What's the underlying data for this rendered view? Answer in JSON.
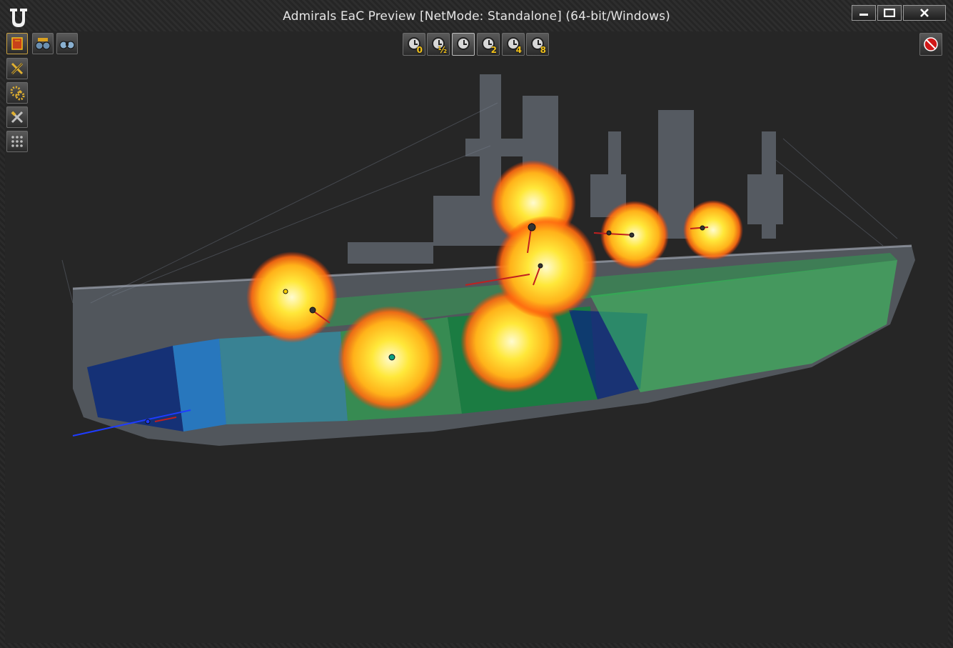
{
  "window": {
    "title": "Admirals EaC Preview [NetMode: Standalone]  (64-bit/Windows)",
    "logo_icon": "unreal-engine-logo",
    "buttons": {
      "minimize_icon": "minimize-icon",
      "maximize_icon": "maximize-icon",
      "close_icon": "close-icon"
    }
  },
  "toolbar": {
    "left_tools": [
      {
        "id": "book",
        "icon": "manual-book-icon",
        "active": true
      },
      {
        "id": "crew",
        "icon": "crew-binoculars-icon",
        "active": false
      },
      {
        "id": "binoculars",
        "icon": "binoculars-icon",
        "active": false
      },
      {
        "id": "hammer",
        "icon": "hammer-pick-icon",
        "active": false
      },
      {
        "id": "gears",
        "icon": "gears-icon",
        "active": false
      },
      {
        "id": "repair",
        "icon": "crossed-tools-icon",
        "active": false
      },
      {
        "id": "grid",
        "icon": "grid-dots-icon",
        "active": false
      }
    ],
    "time_speeds": [
      {
        "label": "0",
        "active": false
      },
      {
        "label": "½",
        "active": false
      },
      {
        "label": "",
        "active": true
      },
      {
        "label": "2",
        "active": false
      },
      {
        "label": "4",
        "active": false
      },
      {
        "label": "8",
        "active": false
      }
    ],
    "stop_icon": "no-entry-icon"
  },
  "scene": {
    "background_color": "#262626",
    "ship_color": "#8a93a0",
    "compartment_colors": [
      "#0b2a7a",
      "#1e7fd6",
      "#2aa0b8",
      "#0a8a3a",
      "#22b84a",
      "#3cd060"
    ],
    "explosion_color": "#ffb21a"
  }
}
